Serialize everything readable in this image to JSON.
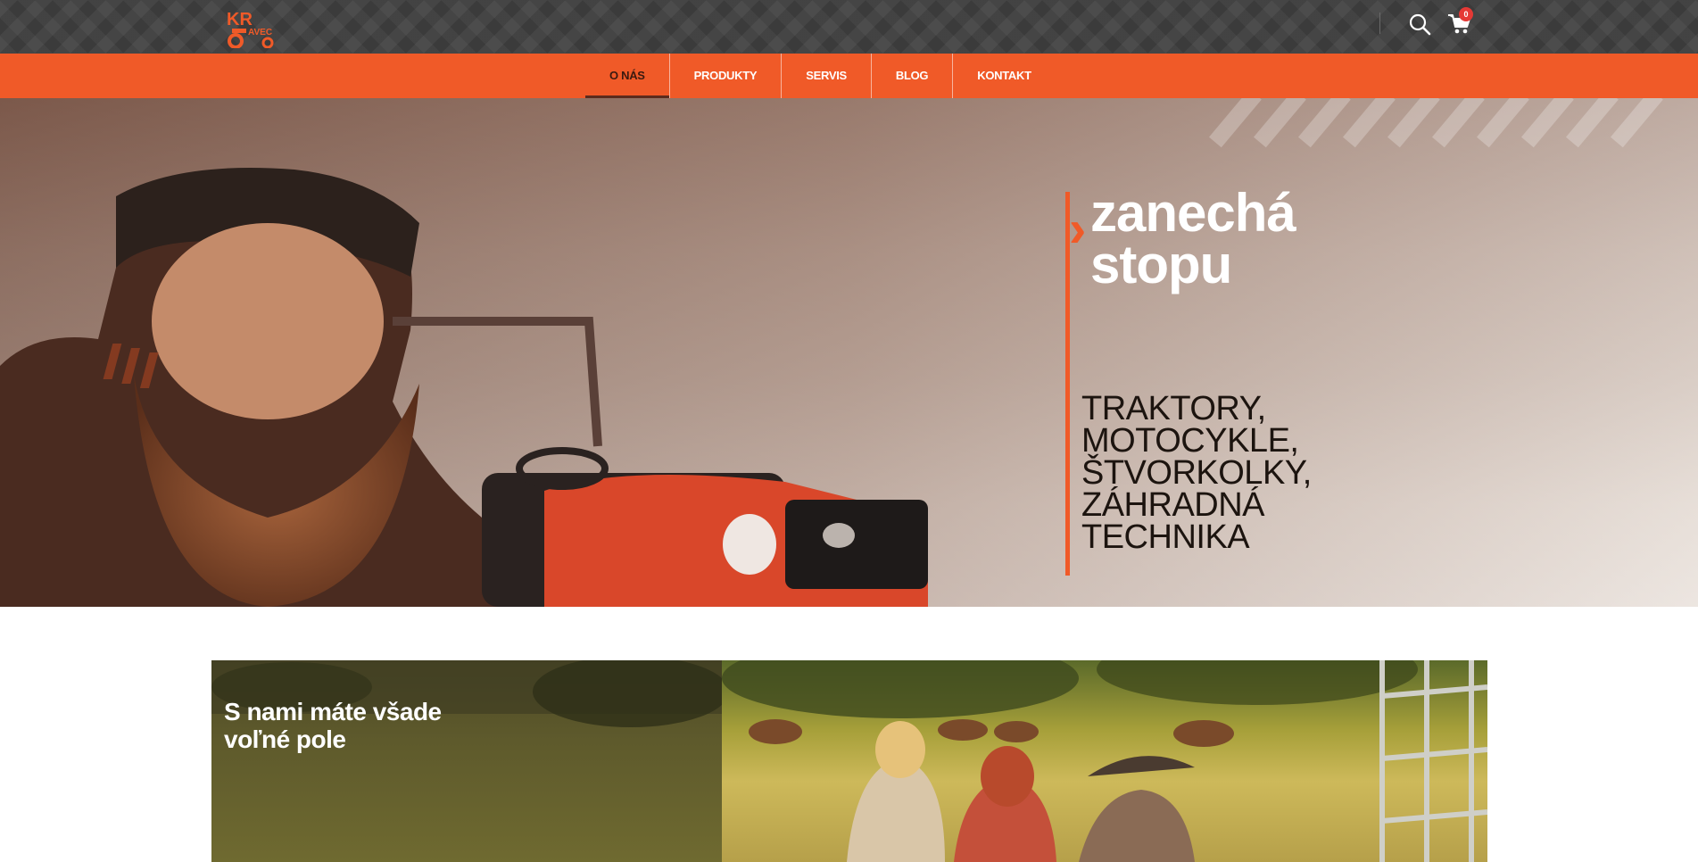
{
  "header": {
    "logo_alt": "Kravec",
    "cart_count": "0",
    "icons": {
      "search": "search-icon",
      "cart": "cart-icon"
    }
  },
  "nav": {
    "items": [
      {
        "label": "O NÁS",
        "active": true
      },
      {
        "label": "PRODUKTY",
        "active": false
      },
      {
        "label": "SERVIS",
        "active": false
      },
      {
        "label": "BLOG",
        "active": false
      },
      {
        "label": "KONTAKT",
        "active": false
      }
    ]
  },
  "hero": {
    "title_line1": "zanechá",
    "title_line2": "stopu",
    "arrow": "›",
    "subtitle_lines": [
      "TRAKTORY,",
      "MOTOCYKLE,",
      "ŠTVORKOLKY,",
      "ZÁHRADNÁ",
      "TECHNIKA"
    ]
  },
  "feature": {
    "title_line1": "S nami máte všade",
    "title_line2": "voľné pole"
  },
  "colors": {
    "accent": "#f05a28",
    "topbar": "#3b3b3b",
    "badge": "#e53935"
  }
}
